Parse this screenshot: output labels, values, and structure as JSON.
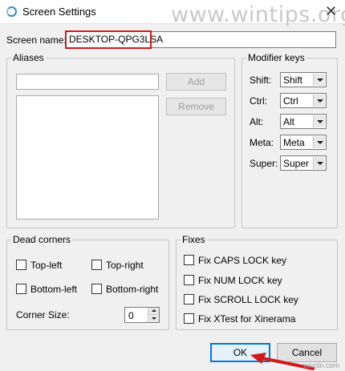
{
  "window": {
    "title": "Screen Settings",
    "close_glyph": "✕",
    "watermark": "www.wintips.org"
  },
  "screen_name": {
    "label": "Screen name:",
    "value": "DESKTOP-QPG3LSA"
  },
  "aliases": {
    "title": "Aliases",
    "input_value": "",
    "add_label": "Add",
    "remove_label": "Remove"
  },
  "modifier_keys": {
    "title": "Modifier keys",
    "rows": [
      {
        "label": "Shift:",
        "value": "Shift"
      },
      {
        "label": "Ctrl:",
        "value": "Ctrl"
      },
      {
        "label": "Alt:",
        "value": "Alt"
      },
      {
        "label": "Meta:",
        "value": "Meta"
      },
      {
        "label": "Super:",
        "value": "Super"
      }
    ]
  },
  "dead_corners": {
    "title": "Dead corners",
    "top_left": "Top-left",
    "top_right": "Top-right",
    "bottom_left": "Bottom-left",
    "bottom_right": "Bottom-right",
    "corner_size_label": "Corner Size:",
    "corner_size_value": "0"
  },
  "fixes": {
    "title": "Fixes",
    "items": [
      {
        "label": "Fix CAPS LOCK key"
      },
      {
        "label": "Fix NUM LOCK key"
      },
      {
        "label": "Fix SCROLL LOCK key"
      },
      {
        "label": "Fix XTest for Xinerama"
      }
    ]
  },
  "buttons": {
    "ok_label": "OK",
    "cancel_label": "Cancel"
  },
  "site_tag": "wsxdn.com",
  "colors": {
    "highlight": "#d11a1a",
    "ok_border": "#0078d7"
  }
}
